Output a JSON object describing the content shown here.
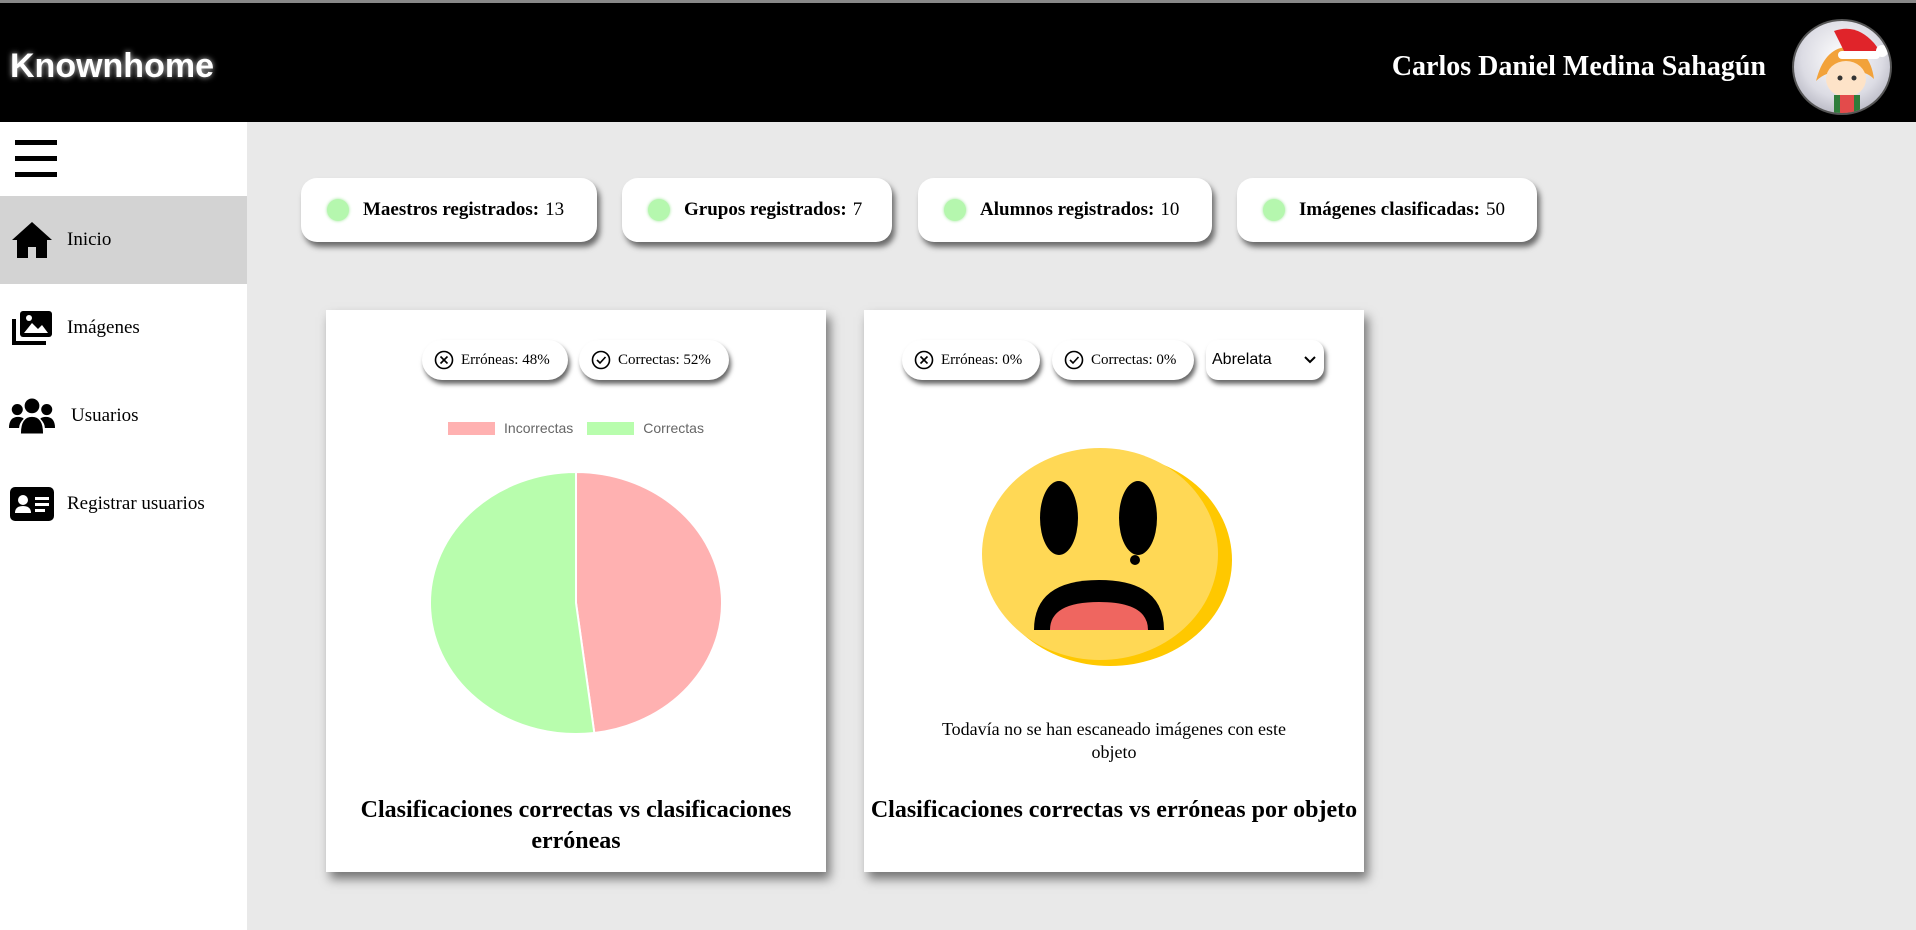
{
  "header": {
    "brand": "Knownhome",
    "user_name": "Carlos Daniel Medina Sahagún"
  },
  "sidebar": {
    "items": [
      {
        "label": "Inicio",
        "icon": "home-icon",
        "active": true
      },
      {
        "label": "Imágenes",
        "icon": "images-icon",
        "active": false
      },
      {
        "label": "Usuarios",
        "icon": "users-icon",
        "active": false
      },
      {
        "label": "Registrar usuarios",
        "icon": "id-card-icon",
        "active": false
      }
    ]
  },
  "stats": [
    {
      "label": "Maestros registrados:",
      "value": "13"
    },
    {
      "label": "Grupos registrados:",
      "value": "7"
    },
    {
      "label": "Alumnos registrados:",
      "value": "10"
    },
    {
      "label": "Imágenes clasificadas:",
      "value": "50"
    }
  ],
  "cards": {
    "overall": {
      "errors_pill": "Erróneas: 48%",
      "correct_pill": "Correctas: 52%",
      "title": "Clasificaciones correctas vs clasificaciones erróneas"
    },
    "by_object": {
      "errors_pill": "Erróneas: 0%",
      "correct_pill": "Correctas: 0%",
      "selected_object": "Abrelata",
      "empty_message": "Todavía no se han escaneado imágenes con este objeto",
      "title": "Clasificaciones correctas vs erróneas por objeto"
    }
  },
  "chart_data": {
    "type": "pie",
    "categories": [
      "Incorrectas",
      "Correctas"
    ],
    "values": [
      48,
      52
    ],
    "colors": [
      "#ffb1b1",
      "#b8fdad"
    ],
    "legend_position": "top"
  },
  "colors": {
    "header_bg": "#000000",
    "active_nav_bg": "#d3d3d3",
    "content_bg": "#e9e9e9",
    "stat_dot": "#b5f7ae"
  }
}
